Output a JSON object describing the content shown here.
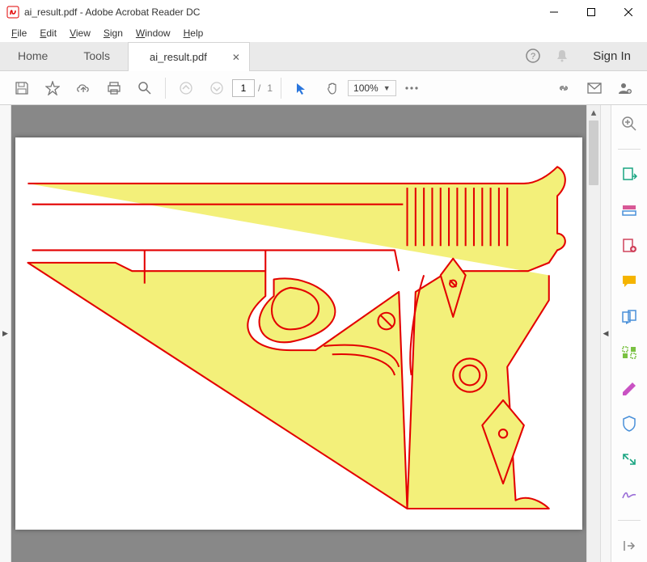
{
  "window": {
    "title": "ai_result.pdf - Adobe Acrobat Reader DC"
  },
  "menubar": {
    "items": [
      "File",
      "Edit",
      "View",
      "Sign",
      "Window",
      "Help"
    ]
  },
  "tabs": {
    "home": "Home",
    "tools": "Tools",
    "active": "ai_result.pdf",
    "signin": "Sign In"
  },
  "toolbar": {
    "page_current": "1",
    "page_sep": "/",
    "page_total": "1",
    "zoom": "100%"
  },
  "document": {
    "filename": "ai_result.pdf",
    "content_description": "vector line drawing of a handgun with red outlines and yellow fill"
  }
}
